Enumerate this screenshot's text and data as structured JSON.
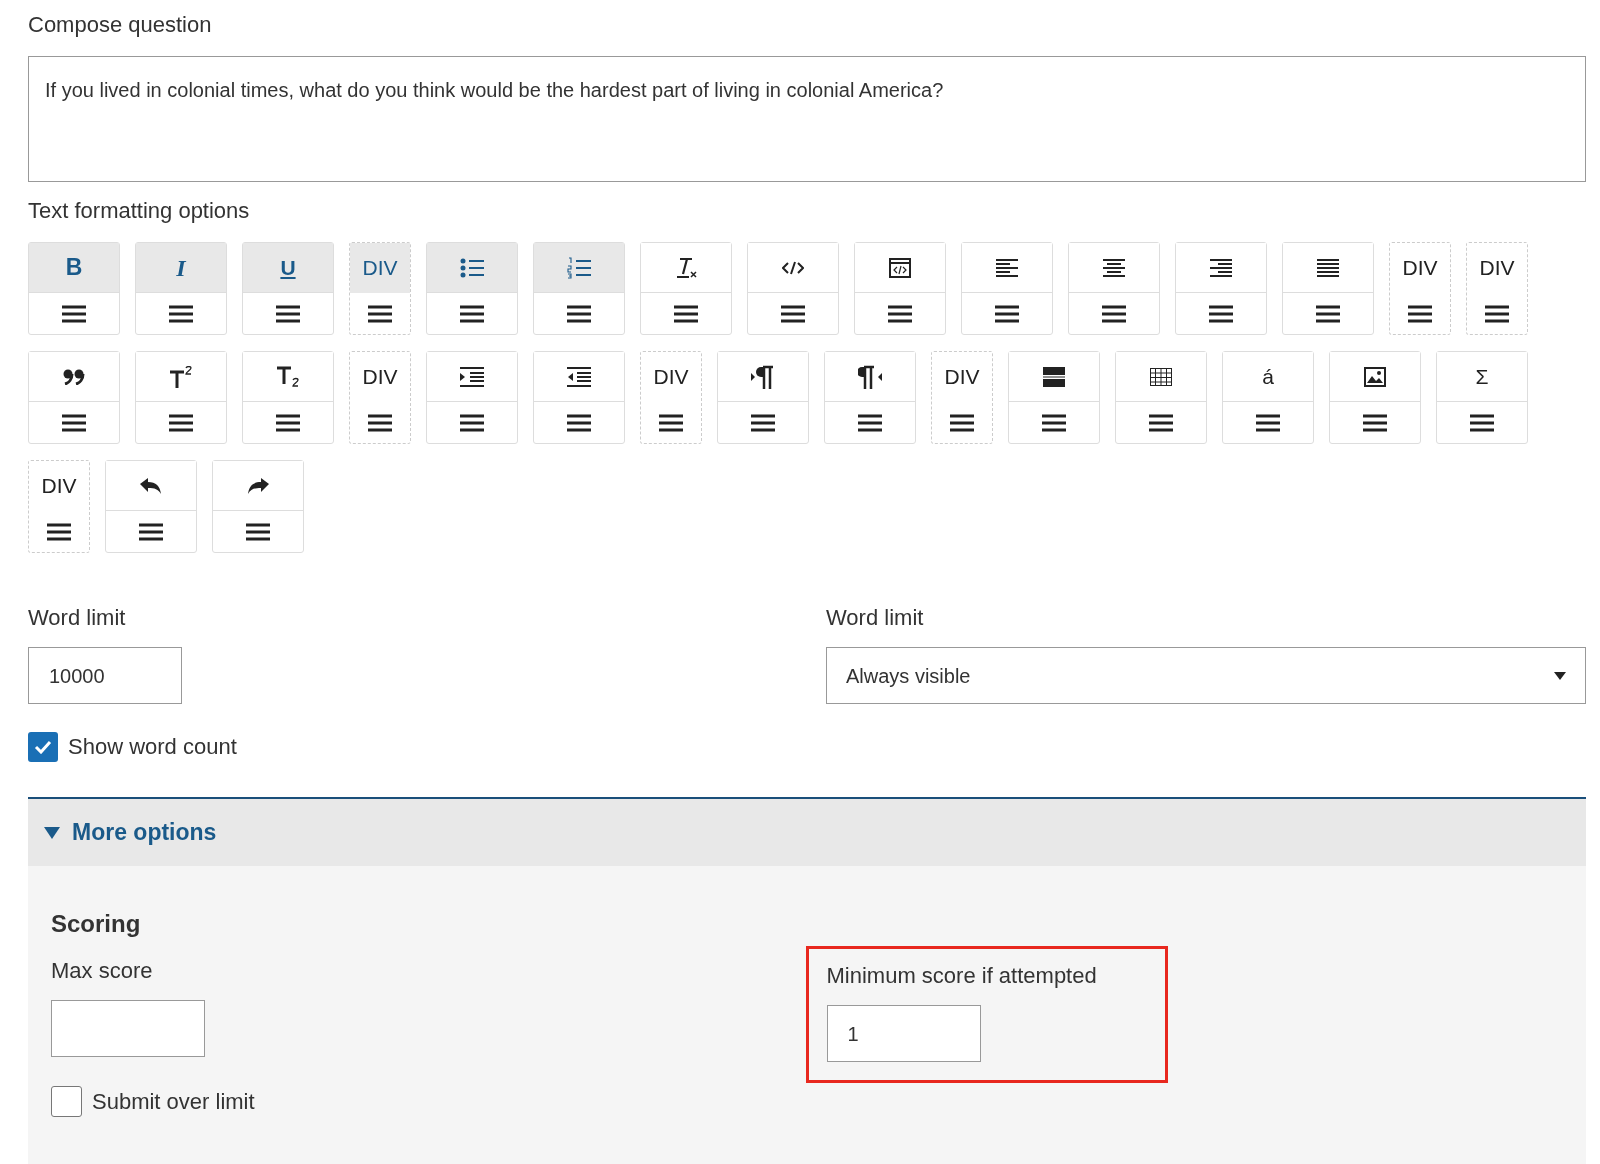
{
  "compose": {
    "label": "Compose question",
    "value": "If you lived in colonial times, what do you think would be the hardest part of living in colonial America?"
  },
  "toolbar": {
    "label": "Text formatting options",
    "rows": [
      [
        {
          "kind": "bold",
          "label": "B",
          "selected": true
        },
        {
          "kind": "italic",
          "label": "I",
          "selected": true
        },
        {
          "kind": "underline",
          "label": "U",
          "selected": true
        },
        {
          "kind": "div",
          "label": "DIV",
          "selected": true
        },
        {
          "kind": "bulleted",
          "selected": true
        },
        {
          "kind": "numbered",
          "selected": true
        },
        {
          "kind": "clearformat",
          "selected": false
        },
        {
          "kind": "code",
          "selected": false
        },
        {
          "kind": "source",
          "selected": false
        },
        {
          "kind": "alignleft",
          "selected": false
        },
        {
          "kind": "aligncenter",
          "selected": false
        },
        {
          "kind": "alignright",
          "selected": false
        },
        {
          "kind": "justify",
          "selected": false
        },
        {
          "kind": "div",
          "label": "DIV",
          "selected": false
        },
        {
          "kind": "div",
          "label": "DIV",
          "selected": false
        }
      ],
      [
        {
          "kind": "quote",
          "selected": false
        },
        {
          "kind": "superscript",
          "selected": false
        },
        {
          "kind": "subscript",
          "selected": false
        },
        {
          "kind": "div",
          "label": "DIV",
          "selected": false
        },
        {
          "kind": "indent",
          "selected": false
        },
        {
          "kind": "outdent",
          "selected": false
        },
        {
          "kind": "div",
          "label": "DIV",
          "selected": false
        },
        {
          "kind": "ltr",
          "selected": false
        },
        {
          "kind": "rtl",
          "selected": false
        },
        {
          "kind": "div",
          "label": "DIV",
          "selected": false
        },
        {
          "kind": "hrule",
          "selected": false
        },
        {
          "kind": "table",
          "selected": false
        },
        {
          "kind": "char",
          "label": "á",
          "selected": false
        },
        {
          "kind": "image",
          "selected": false
        },
        {
          "kind": "char",
          "label": "Σ",
          "selected": false
        }
      ],
      [
        {
          "kind": "div",
          "label": "DIV",
          "selected": false
        },
        {
          "kind": "undo",
          "selected": false
        },
        {
          "kind": "redo",
          "selected": false
        }
      ]
    ]
  },
  "word_limit": {
    "label": "Word limit",
    "value": "10000"
  },
  "word_limit_mode": {
    "label": "Word limit",
    "value": "Always visible"
  },
  "show_word_count": {
    "label": "Show word count",
    "checked": true
  },
  "more_options": {
    "label": "More options",
    "expanded": true,
    "scoring": {
      "title": "Scoring",
      "max_score": {
        "label": "Max score"
      },
      "min_score": {
        "label": "Minimum score if attempted",
        "value": "1",
        "highlighted": true
      },
      "submit_over_limit": {
        "label": "Submit over limit",
        "checked": false
      }
    }
  }
}
